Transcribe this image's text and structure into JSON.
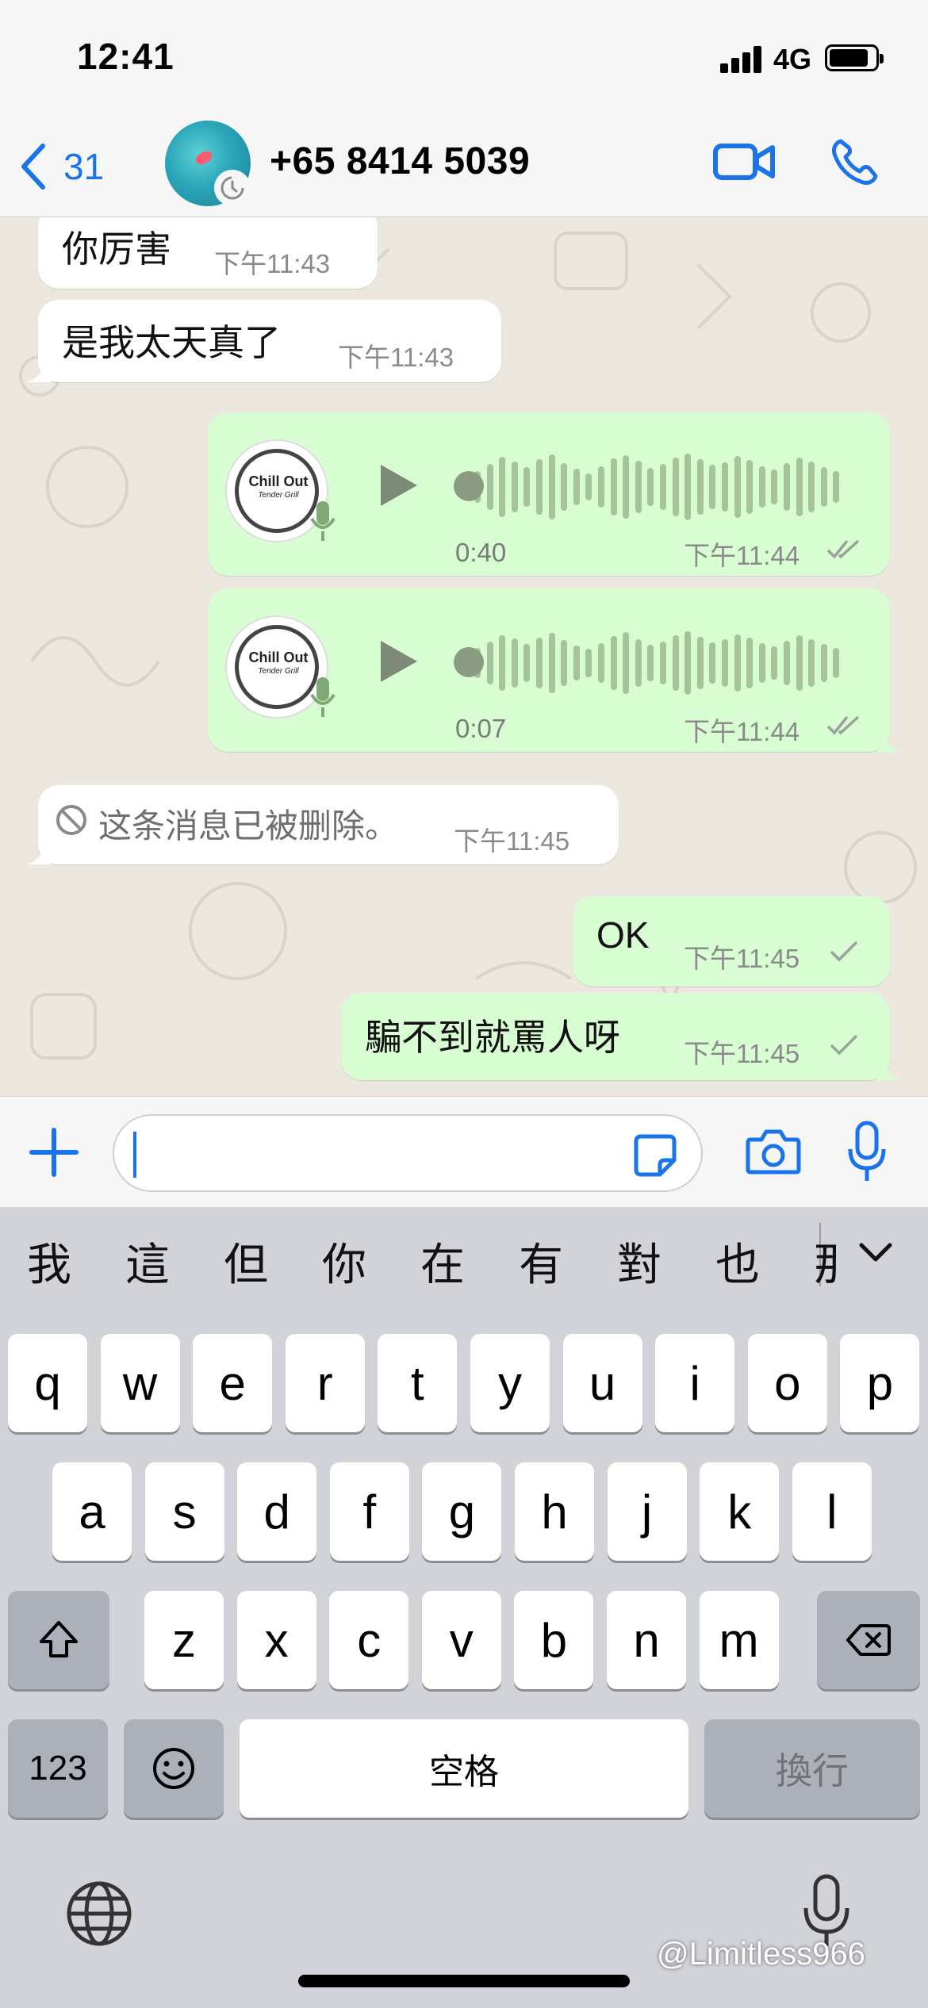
{
  "status_bar": {
    "time": "12:41",
    "network": "4G"
  },
  "header": {
    "back_count": "31",
    "contact_name": "+65 8414 5039",
    "icons": {
      "back": "chevron-left-icon",
      "timer": "disappearing-timer-icon",
      "video": "video-call-icon",
      "phone": "voice-call-icon"
    }
  },
  "messages": [
    {
      "direction": "in",
      "type": "text",
      "text": "你厉害",
      "time": "下午11:43"
    },
    {
      "direction": "in",
      "type": "text",
      "text": "是我太天真了",
      "time": "下午11:43"
    },
    {
      "direction": "out",
      "type": "voice",
      "duration": "0:40",
      "time": "下午11:44",
      "status": "read",
      "avatar_text": "Chill Out",
      "avatar_subtext": "Tender Grill"
    },
    {
      "direction": "out",
      "type": "voice",
      "duration": "0:07",
      "time": "下午11:44",
      "status": "read",
      "avatar_text": "Chill Out",
      "avatar_subtext": "Tender Grill"
    },
    {
      "direction": "in",
      "type": "deleted",
      "text": "这条消息已被删除。",
      "time": "下午11:45"
    },
    {
      "direction": "out",
      "type": "text",
      "text": "OK",
      "time": "下午11:45",
      "status": "sent"
    },
    {
      "direction": "out",
      "type": "text",
      "text": "騙不到就罵人呀",
      "time": "下午11:45",
      "status": "sent"
    }
  ],
  "input_bar": {
    "placeholder": "",
    "icons": [
      "plus-icon",
      "sticker-icon",
      "camera-icon",
      "microphone-icon"
    ]
  },
  "keyboard": {
    "candidates": [
      "我",
      "這",
      "但",
      "你",
      "在",
      "有",
      "對",
      "也",
      "那"
    ],
    "row1": [
      "q",
      "w",
      "e",
      "r",
      "t",
      "y",
      "u",
      "i",
      "o",
      "p"
    ],
    "row2": [
      "a",
      "s",
      "d",
      "f",
      "g",
      "h",
      "j",
      "k",
      "l"
    ],
    "row3": [
      "z",
      "x",
      "c",
      "v",
      "b",
      "n",
      "m"
    ],
    "numbers_key": "123",
    "space_key": "空格",
    "return_key": "換行"
  },
  "watermark": "@Limitless966",
  "colors": {
    "accent": "#1a73e8",
    "outgoing_bubble": "#d9fdd3",
    "incoming_bubble": "#ffffff",
    "chat_background": "#ece8e0",
    "keyboard_background": "#d1d3d9"
  }
}
